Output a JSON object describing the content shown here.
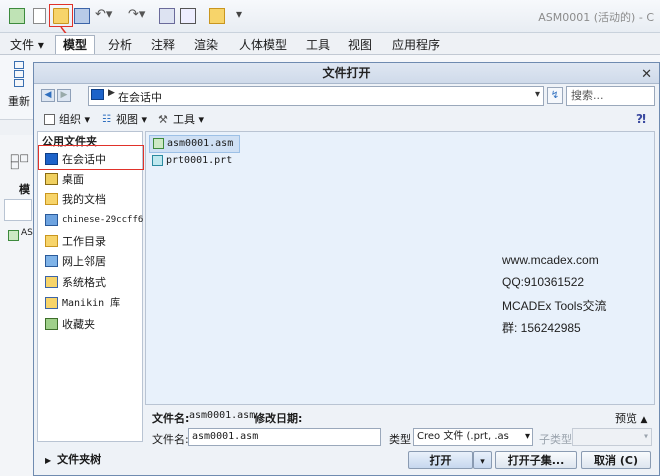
{
  "app": {
    "title": "ASM0001 (活动的) - C",
    "colors": {
      "accent": "#2f6fbf",
      "highlight": "#e0322a"
    }
  },
  "menubar": {
    "tabs": [
      {
        "label": "文件 ▾"
      },
      {
        "label": "模型"
      },
      {
        "label": "分析"
      },
      {
        "label": "注释"
      },
      {
        "label": "渲染"
      },
      {
        "label": "人体模型"
      },
      {
        "label": "工具"
      },
      {
        "label": "视图"
      },
      {
        "label": "应用程序"
      }
    ]
  },
  "ribbon": {
    "regen_label": "重新"
  },
  "leftpanel": {
    "tab_label": "模",
    "tree_item": "ASI"
  },
  "dialog": {
    "title": "文件打开",
    "close_icon": "close-icon",
    "path": "在会话中",
    "search_placeholder": "搜索...",
    "toolbar": {
      "organize": "组织",
      "views": "视图",
      "tools": "工具"
    },
    "sidebar": {
      "heading": "公用文件夹",
      "items": [
        {
          "label": "在会话中",
          "icon": "monitor-icon"
        },
        {
          "label": "桌面",
          "icon": "desktop-icon"
        },
        {
          "label": "我的文档",
          "icon": "documents-icon"
        },
        {
          "label": "chinese-29ccff6",
          "icon": "computer-icon"
        },
        {
          "label": "工作目录",
          "icon": "working-dir-icon"
        },
        {
          "label": "网上邻居",
          "icon": "network-icon"
        },
        {
          "label": "系统格式",
          "icon": "system-format-icon"
        },
        {
          "label": "Manikin 库",
          "icon": "manikin-library-icon"
        },
        {
          "label": "收藏夹",
          "icon": "favorites-icon"
        }
      ],
      "folder_tree": "文件夹树"
    },
    "files": [
      {
        "name": "asm0001.asm",
        "icon": "assembly-file-icon"
      },
      {
        "name": "prt0001.prt",
        "icon": "part-file-icon"
      }
    ],
    "watermark": [
      "www.mcadex.com",
      "QQ:910361522",
      "MCADEx Tools交流",
      "群: 156242985"
    ],
    "info": {
      "filename_label": "文件名:",
      "filename_value": "asm0001.asm",
      "modified_label": "修改日期:",
      "preview": "预览"
    },
    "fields": {
      "filename_label": "文件名:",
      "filename_value": "asm0001.asm",
      "type_label": "类型",
      "type_value": "Creo 文件 (.prt, .as",
      "subtype_label": "子类型",
      "subtype_value": ""
    },
    "buttons": {
      "open": "打开",
      "open_subset": "打开子集...",
      "cancel": "取消 (C)"
    }
  }
}
